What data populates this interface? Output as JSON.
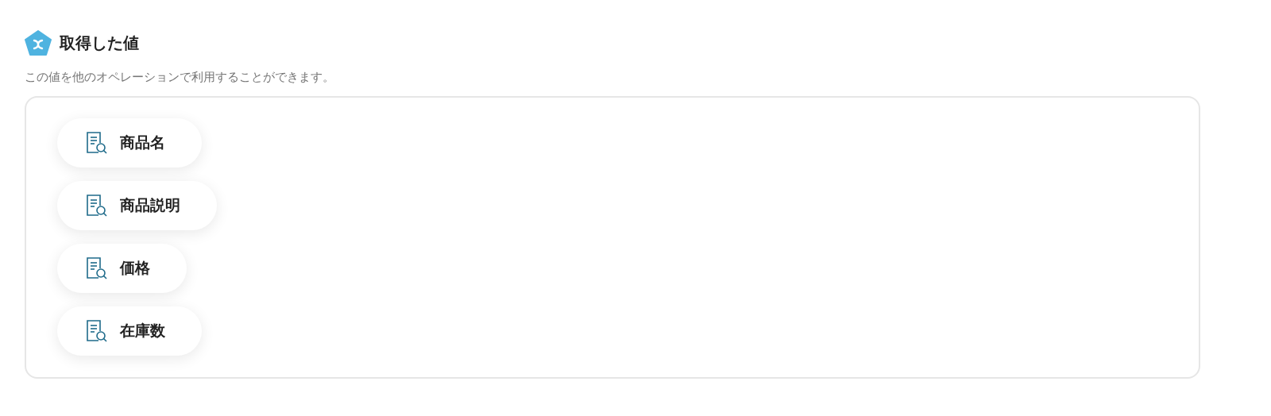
{
  "section": {
    "title": "取得した値",
    "description": "この値を他のオペレーションで利用することができます。"
  },
  "values": [
    {
      "label": "商品名"
    },
    {
      "label": "商品説明"
    },
    {
      "label": "価格"
    },
    {
      "label": "在庫数"
    }
  ]
}
